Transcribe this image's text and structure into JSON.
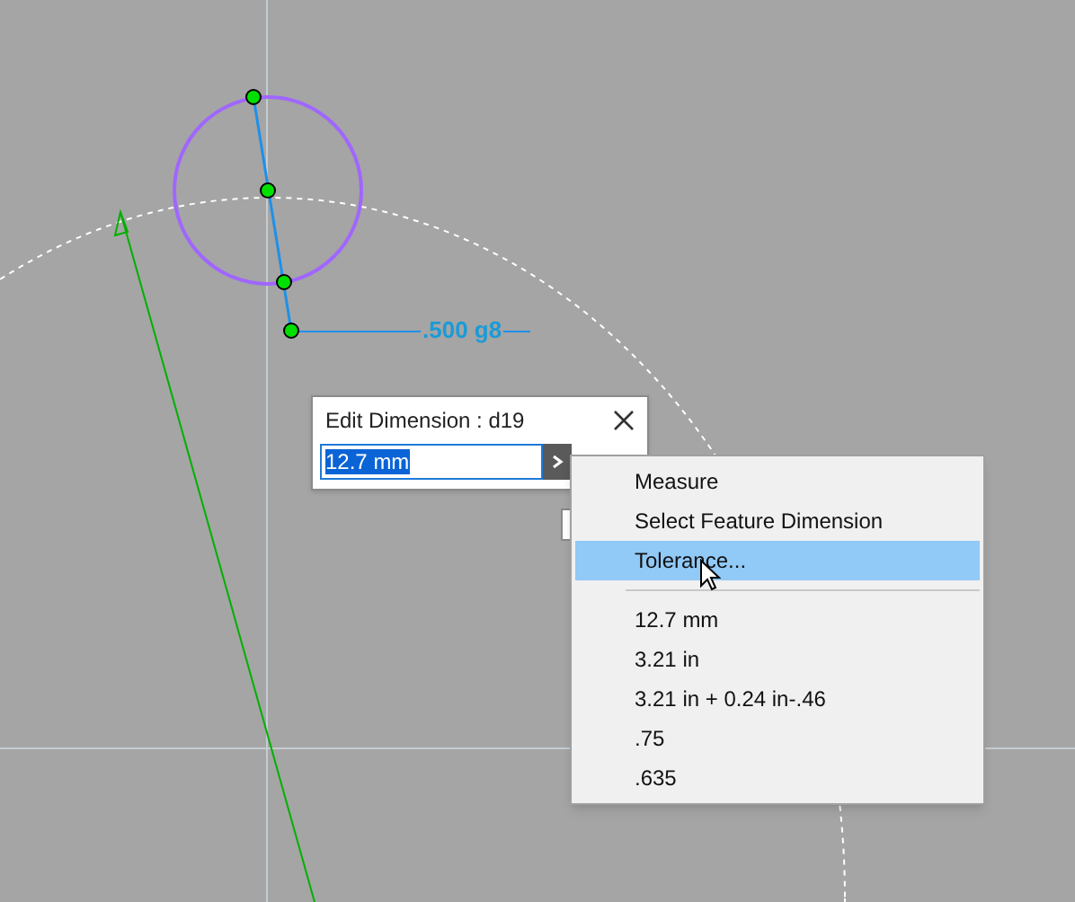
{
  "dimension_label": ".500 g8",
  "dialog": {
    "title": "Edit Dimension : d19",
    "value": "12.7 mm",
    "value_selected": true
  },
  "menu": {
    "items": [
      {
        "kind": "item",
        "label": "Measure",
        "selected": false
      },
      {
        "kind": "item",
        "label": "Select Feature Dimension",
        "selected": false
      },
      {
        "kind": "item",
        "label": "Tolerance...",
        "selected": true
      },
      {
        "kind": "separator"
      },
      {
        "kind": "item",
        "label": "12.7 mm",
        "selected": false
      },
      {
        "kind": "item",
        "label": "3.21 in",
        "selected": false
      },
      {
        "kind": "item",
        "label": "3.21 in + 0.24 in-.46",
        "selected": false
      },
      {
        "kind": "item",
        "label": ".75",
        "selected": false
      },
      {
        "kind": "item",
        "label": ".635",
        "selected": false
      }
    ]
  }
}
